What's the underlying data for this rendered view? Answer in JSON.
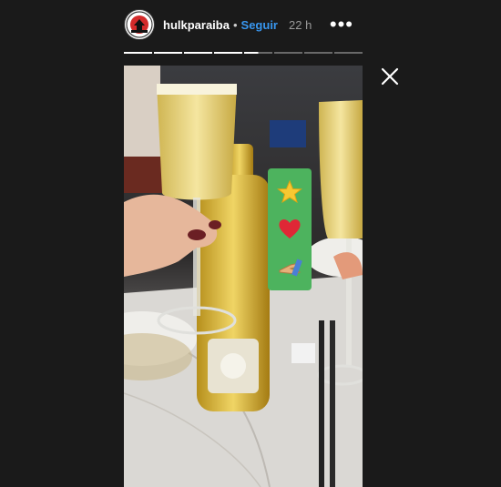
{
  "header": {
    "username": "hulkparaiba",
    "separator": "•",
    "follow_label": "Seguir",
    "time_ago": "22 h",
    "more_label": "•••"
  },
  "progress": {
    "segments": 8,
    "completed": 4,
    "current_fraction": 0.5
  },
  "story": {
    "media_description_icon": "photo-icon"
  },
  "reaction_bar": {
    "items": [
      {
        "icon": "star-emoji-icon"
      },
      {
        "icon": "heart-emoji-icon"
      },
      {
        "icon": "prayer-hands-emoji-icon"
      }
    ],
    "color": "#4db35e"
  },
  "colors": {
    "background": "#1a1a1a",
    "link": "#3897f0"
  }
}
